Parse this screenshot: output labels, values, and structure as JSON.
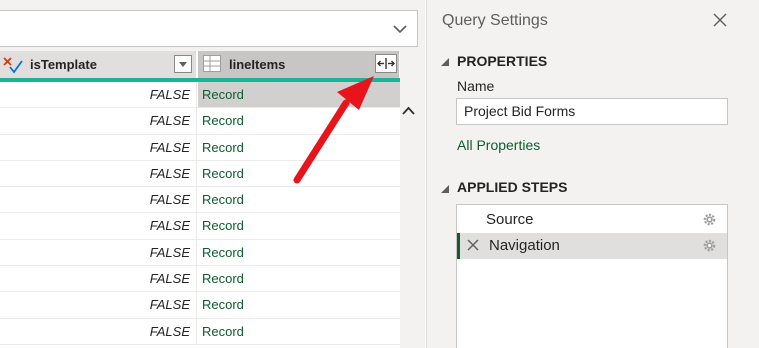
{
  "grid": {
    "columns": [
      {
        "name": "isTemplate",
        "type_icon": "logical-type-icon"
      },
      {
        "name": "lineItems",
        "type_icon": "table-type-icon"
      }
    ],
    "rows": [
      {
        "isTemplate": "FALSE",
        "lineItems": "Record"
      },
      {
        "isTemplate": "FALSE",
        "lineItems": "Record"
      },
      {
        "isTemplate": "FALSE",
        "lineItems": "Record"
      },
      {
        "isTemplate": "FALSE",
        "lineItems": "Record"
      },
      {
        "isTemplate": "FALSE",
        "lineItems": "Record"
      },
      {
        "isTemplate": "FALSE",
        "lineItems": "Record"
      },
      {
        "isTemplate": "FALSE",
        "lineItems": "Record"
      },
      {
        "isTemplate": "FALSE",
        "lineItems": "Record"
      },
      {
        "isTemplate": "FALSE",
        "lineItems": "Record"
      },
      {
        "isTemplate": "FALSE",
        "lineItems": "Record"
      }
    ],
    "selected_row": 0,
    "column_quality_color": "#1ab394",
    "annotation_arrow_color": "#e8141b"
  },
  "query_settings": {
    "title": "Query Settings",
    "properties": {
      "heading": "PROPERTIES",
      "name_label": "Name",
      "name_value": "Project Bid Forms",
      "all_properties_link": "All Properties"
    },
    "applied_steps": {
      "heading": "APPLIED STEPS",
      "steps": [
        {
          "label": "Source",
          "active": false
        },
        {
          "label": "Navigation",
          "active": true
        }
      ]
    }
  },
  "colors": {
    "accent_green": "#0e5c2f",
    "pane_background": "#f3f2f1"
  }
}
